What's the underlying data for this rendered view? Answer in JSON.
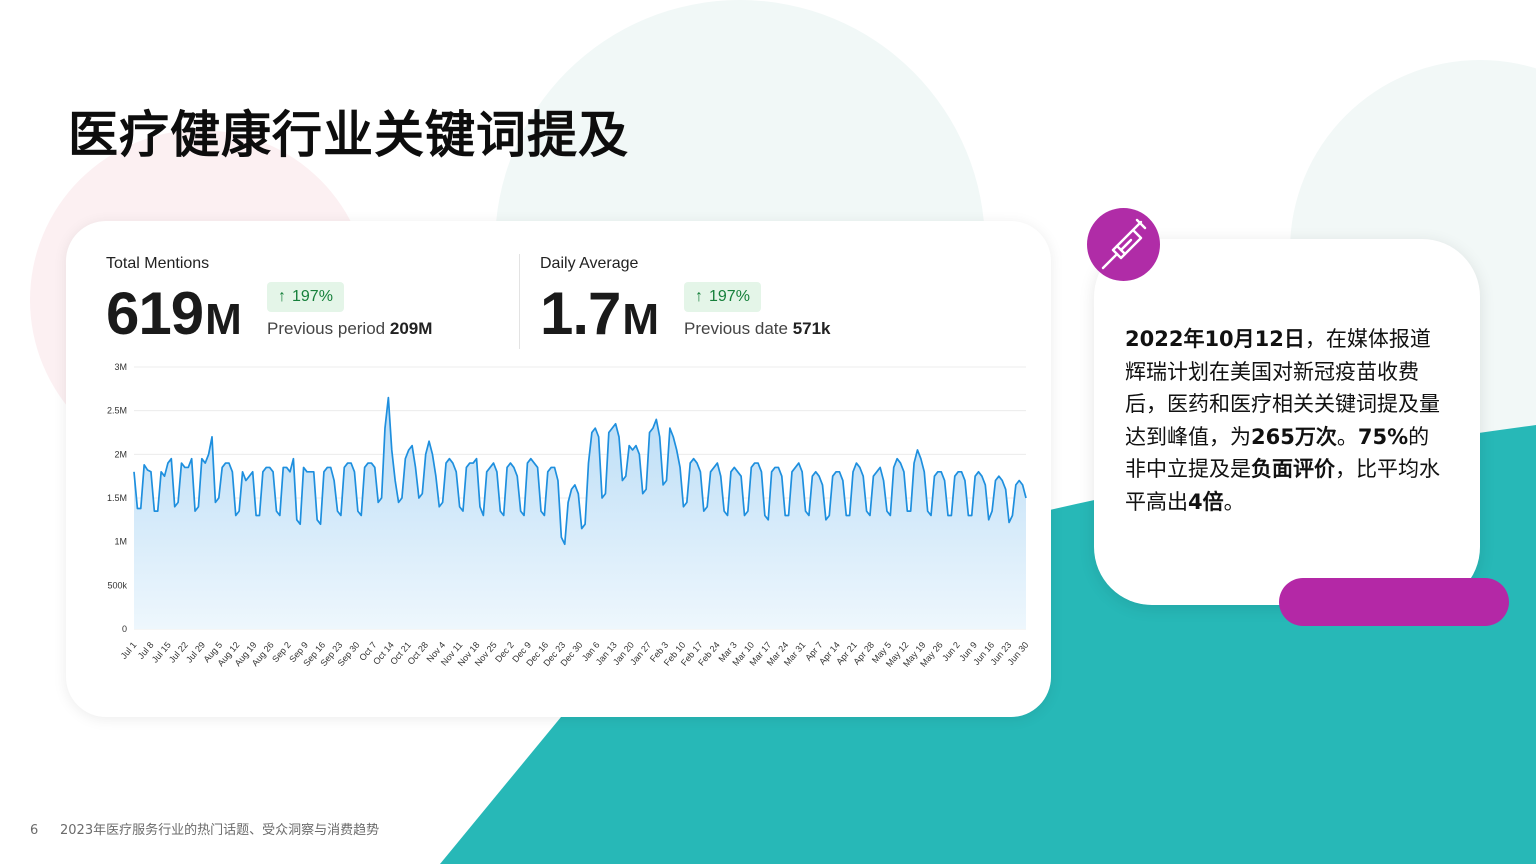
{
  "page": {
    "title": "医疗健康行业关键词提及",
    "number": "6",
    "footer": "2023年医疗服务行业的热门话题、受众洞察与消费趋势"
  },
  "colors": {
    "teal": "#27b8b7",
    "magenta": "#b02ca7",
    "line": "#1e8fde",
    "area_top": "#b9dcf6",
    "area_bottom": "#eaf5fd",
    "badge_bg": "#e4f5e8",
    "badge_text": "#16803b"
  },
  "stats": {
    "total": {
      "label": "Total Mentions",
      "value": "619",
      "unit": "M",
      "change": "197%",
      "change_icon": "arrow-up-icon",
      "prev_label": "Previous period",
      "prev_value": "209M"
    },
    "daily": {
      "label": "Daily Average",
      "value": "1.7",
      "unit": "M",
      "change": "197%",
      "change_icon": "arrow-up-icon",
      "prev_label": "Previous date",
      "prev_value": "571k"
    }
  },
  "chart_data": {
    "type": "area",
    "title": "",
    "xlabel": "",
    "ylabel": "",
    "ylim": [
      0,
      3000000
    ],
    "yticks": [
      {
        "value": 0,
        "label": "0"
      },
      {
        "value": 500000,
        "label": "500k"
      },
      {
        "value": 1000000,
        "label": "1M"
      },
      {
        "value": 1500000,
        "label": "1.5M"
      },
      {
        "value": 2000000,
        "label": "2M"
      },
      {
        "value": 2500000,
        "label": "2.5M"
      },
      {
        "value": 3000000,
        "label": "3M"
      }
    ],
    "grid": true,
    "xticks": [
      "Jul 1",
      "Jul 8",
      "Jul 15",
      "Jul 22",
      "Jul 29",
      "Aug 5",
      "Aug 12",
      "Aug 19",
      "Aug 26",
      "Sep 2",
      "Sep 9",
      "Sep 16",
      "Sep 23",
      "Sep 30",
      "Oct 7",
      "Oct 14",
      "Oct 21",
      "Oct 28",
      "Nov 4",
      "Nov 11",
      "Nov 18",
      "Nov 25",
      "Dec 2",
      "Dec 9",
      "Dec 16",
      "Dec 23",
      "Dec 30",
      "Jan 6",
      "Jan 13",
      "Jan 20",
      "Jan 27",
      "Feb 3",
      "Feb 10",
      "Feb 17",
      "Feb 24",
      "Mar 3",
      "Mar 10",
      "Mar 17",
      "Mar 24",
      "Mar 31",
      "Apr 7",
      "Apr 14",
      "Apr 21",
      "Apr 28",
      "May 5",
      "May 12",
      "May 19",
      "May 26",
      "Jun 2",
      "Jun 9",
      "Jun 16",
      "Jun 23",
      "Jun 30"
    ],
    "series": [
      {
        "values": [
          1.8,
          1.38,
          1.38,
          1.88,
          1.82,
          1.8,
          1.35,
          1.35,
          1.8,
          1.75,
          1.9,
          1.95,
          1.4,
          1.45,
          1.9,
          1.85,
          1.85,
          1.95,
          1.35,
          1.4,
          1.95,
          1.9,
          2.0,
          2.2,
          1.45,
          1.5,
          1.85,
          1.9,
          1.9,
          1.8,
          1.3,
          1.35,
          1.8,
          1.7,
          1.75,
          1.8,
          1.3,
          1.3,
          1.8,
          1.85,
          1.85,
          1.8,
          1.35,
          1.3,
          1.85,
          1.85,
          1.8,
          1.95,
          1.25,
          1.2,
          1.85,
          1.8,
          1.8,
          1.8,
          1.25,
          1.2,
          1.8,
          1.85,
          1.85,
          1.7,
          1.35,
          1.3,
          1.85,
          1.9,
          1.9,
          1.8,
          1.35,
          1.3,
          1.85,
          1.9,
          1.9,
          1.85,
          1.45,
          1.5,
          2.3,
          2.65,
          2.05,
          1.7,
          1.45,
          1.5,
          1.95,
          2.05,
          2.1,
          1.85,
          1.5,
          1.55,
          2.0,
          2.15,
          2.0,
          1.75,
          1.4,
          1.45,
          1.9,
          1.95,
          1.9,
          1.8,
          1.4,
          1.35,
          1.85,
          1.9,
          1.9,
          1.95,
          1.4,
          1.3,
          1.8,
          1.85,
          1.9,
          1.8,
          1.35,
          1.3,
          1.85,
          1.9,
          1.85,
          1.75,
          1.35,
          1.3,
          1.9,
          1.95,
          1.9,
          1.85,
          1.35,
          1.3,
          1.8,
          1.85,
          1.85,
          1.7,
          1.05,
          0.97,
          1.45,
          1.6,
          1.65,
          1.55,
          1.15,
          1.2,
          1.9,
          2.25,
          2.3,
          2.2,
          1.5,
          1.55,
          2.25,
          2.3,
          2.35,
          2.2,
          1.7,
          1.75,
          2.1,
          2.05,
          2.1,
          2.0,
          1.55,
          1.6,
          2.25,
          2.3,
          2.4,
          2.2,
          1.65,
          1.7,
          2.3,
          2.2,
          2.05,
          1.85,
          1.4,
          1.45,
          1.9,
          1.95,
          1.9,
          1.8,
          1.35,
          1.4,
          1.8,
          1.85,
          1.9,
          1.75,
          1.35,
          1.3,
          1.8,
          1.85,
          1.8,
          1.75,
          1.3,
          1.35,
          1.85,
          1.9,
          1.9,
          1.8,
          1.3,
          1.25,
          1.8,
          1.85,
          1.85,
          1.75,
          1.3,
          1.3,
          1.8,
          1.85,
          1.9,
          1.8,
          1.35,
          1.3,
          1.75,
          1.8,
          1.75,
          1.65,
          1.25,
          1.3,
          1.75,
          1.8,
          1.8,
          1.7,
          1.3,
          1.3,
          1.8,
          1.9,
          1.85,
          1.75,
          1.35,
          1.3,
          1.75,
          1.8,
          1.85,
          1.7,
          1.35,
          1.3,
          1.85,
          1.95,
          1.9,
          1.8,
          1.35,
          1.35,
          1.9,
          2.05,
          1.95,
          1.8,
          1.35,
          1.3,
          1.75,
          1.8,
          1.8,
          1.7,
          1.3,
          1.3,
          1.75,
          1.8,
          1.8,
          1.7,
          1.3,
          1.3,
          1.75,
          1.8,
          1.75,
          1.65,
          1.25,
          1.35,
          1.7,
          1.75,
          1.7,
          1.6,
          1.22,
          1.3,
          1.65,
          1.7,
          1.65,
          1.5
        ]
      }
    ]
  },
  "info": {
    "syringe_icon": "syringe-icon",
    "bold1": "2022年10月12日",
    "text1": "，在媒体报道辉瑞计划在美国对新冠疫苗收费后，医药和医疗相关关键词提及量达到峰值，为",
    "bold2": "265万次",
    "text2": "。",
    "bold3": "75%",
    "text3": "的非中立提及是",
    "bold4": "负面评价",
    "text4": "，比平均水平高出",
    "bold5": "4倍",
    "text5": "。"
  }
}
